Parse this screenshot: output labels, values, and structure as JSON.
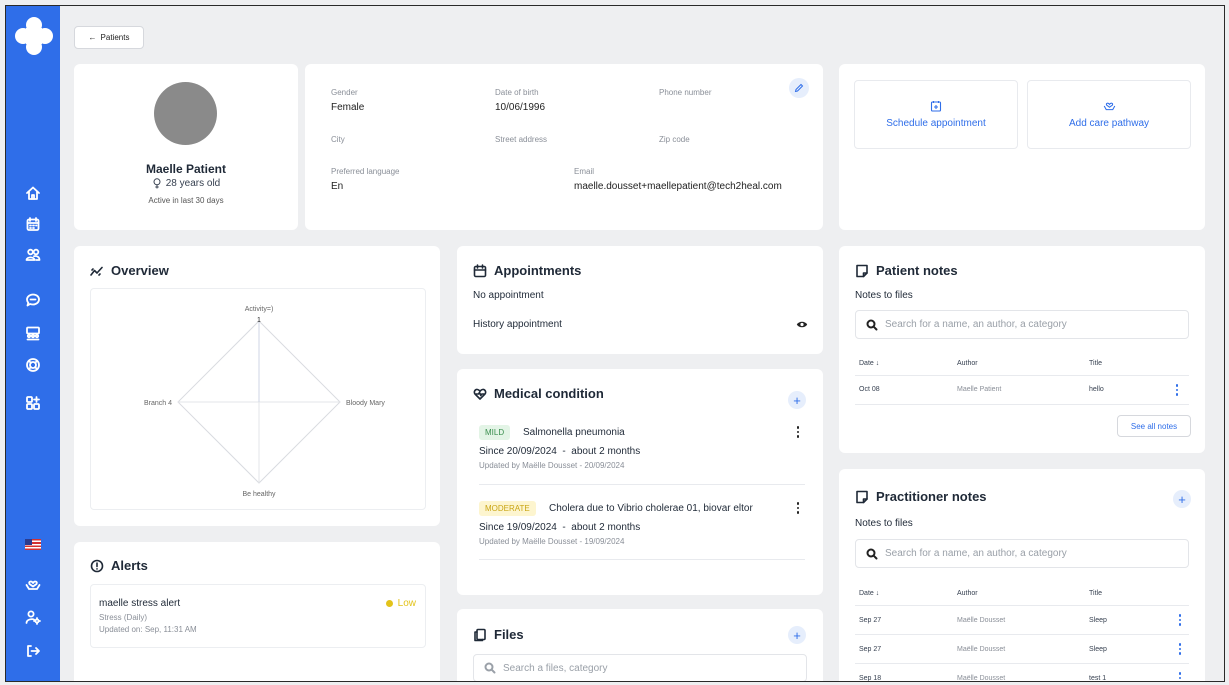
{
  "nav": {
    "icons": [
      "home-icon",
      "calendar-icon",
      "users-icon",
      "chat-icon",
      "team-icon",
      "lifebuoy-icon",
      "apps-icon"
    ],
    "bottom_icons": [
      "flag-us-icon",
      "care-hands-icon",
      "user-settings-icon",
      "logout-icon"
    ]
  },
  "back_button": {
    "label": "Patients"
  },
  "profile": {
    "name": "Maelle Patient",
    "age": "28 years old",
    "activity": "Active in last 30 days"
  },
  "details": {
    "gender_label": "Gender",
    "gender": "Female",
    "dob_label": "Date of birth",
    "dob": "10/06/1996",
    "phone_label": "Phone number",
    "city_label": "City",
    "street_label": "Street address",
    "zip_label": "Zip code",
    "language_label": "Preferred language",
    "language": "En",
    "email_label": "Email",
    "email": "maelle.dousset+maellepatient@tech2heal.com"
  },
  "actions": {
    "schedule": "Schedule appointment",
    "care_pathway": "Add care pathway"
  },
  "overview": {
    "title": "Overview",
    "chart_data": {
      "type": "radar",
      "categories": [
        "Activity=)",
        "Bloody Mary",
        "Be healthy",
        "Branch 4"
      ],
      "values": [
        1,
        0,
        0,
        0
      ],
      "tick_label": "1"
    }
  },
  "appointments": {
    "title": "Appointments",
    "empty": "No appointment",
    "history": "History appointment"
  },
  "medical": {
    "title": "Medical condition",
    "items": [
      {
        "severity": "MILD",
        "name": "Salmonella pneumonia",
        "since": "Since 20/09/2024",
        "duration": "about 2 months",
        "updated": "Updated by Maëlle Dousset - 20/09/2024"
      },
      {
        "severity": "MODERATE",
        "name": "Cholera due to Vibrio cholerae 01, biovar eltor",
        "since": "Since 19/09/2024",
        "duration": "about 2 months",
        "updated": "Updated by Maëlle Dousset - 19/09/2024"
      }
    ]
  },
  "files": {
    "title": "Files",
    "search_placeholder": "Search a files, category"
  },
  "alerts": {
    "title": "Alerts",
    "items": [
      {
        "name": "maelle stress alert",
        "type": "Stress (Daily)",
        "updated": "Updated on: Sep, 11:31 AM",
        "level": "Low"
      }
    ]
  },
  "patient_notes": {
    "title": "Patient notes",
    "subtitle": "Notes to files",
    "search_placeholder": "Search for a name, an author, a category",
    "columns": [
      "Date",
      "Author",
      "Title"
    ],
    "rows": [
      {
        "date": "Oct 08",
        "author": "Maelle Patient",
        "title": "hello"
      }
    ],
    "see_all": "See all notes"
  },
  "practitioner_notes": {
    "title": "Practitioner notes",
    "subtitle": "Notes to files",
    "search_placeholder": "Search for a name, an author, a category",
    "columns": [
      "Date",
      "Author",
      "Title"
    ],
    "rows": [
      {
        "date": "Sep 27",
        "author": "Maëlle Dousset",
        "title": "Sleep"
      },
      {
        "date": "Sep 27",
        "author": "Maëlle Dousset",
        "title": "Sleep"
      },
      {
        "date": "Sep 18",
        "author": "Maëlle Dousset",
        "title": "test 1"
      }
    ]
  },
  "colors": {
    "accent": "#2f6ee9",
    "mild_bg": "#e3f4e6",
    "mild_text": "#3a8f4f",
    "moderate_bg": "#fdf5cf",
    "moderate_text": "#c9a514",
    "low": "#e3c31a"
  }
}
